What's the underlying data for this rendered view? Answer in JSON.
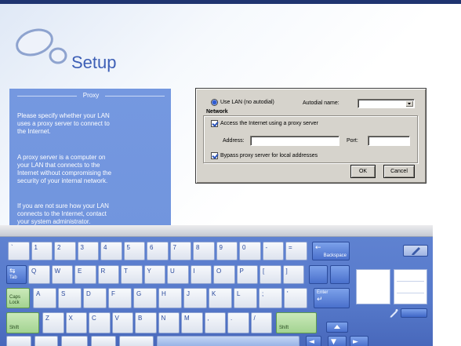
{
  "header": {
    "title": "Setup",
    "logo_icon": "bubbles-logo-icon"
  },
  "proxy_panel": {
    "heading": "Proxy",
    "paragraphs": [
      [
        "Please specify whether your LAN",
        "uses a proxy server to connect to",
        "the Internet."
      ],
      [
        "A proxy server is a computer on",
        "your LAN that connects to the",
        "Internet without compromising the",
        "security of your internal network."
      ],
      [
        "If you are not sure how your LAN",
        "connects to the Internet, contact",
        "your system administrator."
      ]
    ]
  },
  "dialog": {
    "use_lan_label": "Use LAN (no autodial)",
    "use_lan_selected": true,
    "autodial_label": "Autodial name:",
    "autodial_value": "",
    "network_label": "Network",
    "proxy_label": "Access the Internet using a proxy server",
    "proxy_checked": true,
    "address_label": "Address:",
    "address_value": "",
    "port_label": "Port:",
    "port_value": "",
    "bypass_label": "Bypass proxy server for local addresses",
    "bypass_checked": true,
    "ok_label": "OK",
    "cancel_label": "Cancel"
  },
  "keyboard": {
    "row1": [
      "`",
      "1",
      "2",
      "3",
      "4",
      "5",
      "6",
      "7",
      "8",
      "9",
      "0",
      "-",
      "=",
      "Backspace"
    ],
    "row2": [
      "Tab",
      "Q",
      "W",
      "E",
      "R",
      "T",
      "Y",
      "U",
      "I",
      "O",
      "P",
      "[",
      "]",
      "",
      ""
    ],
    "row3": [
      "Caps Lock",
      "A",
      "S",
      "D",
      "F",
      "G",
      "H",
      "J",
      "K",
      "L",
      ";",
      "'",
      "Enter"
    ],
    "row4": [
      "Shift",
      "Z",
      "X",
      "C",
      "V",
      "B",
      "N",
      "M",
      ",",
      ".",
      "/",
      "Shift"
    ],
    "row5": [
      "",
      "",
      "",
      "",
      "",
      "",
      "",
      "",
      ""
    ],
    "icons": {
      "backspace": "backspace-arrow-icon",
      "tab": "tab-arrows-icon",
      "enter": "enter-arrow-icon",
      "left": "left-arrow-icon",
      "down": "down-arrow-icon",
      "right": "right-arrow-icon",
      "up": "up-arrow-icon",
      "pen": "pen-icon"
    }
  },
  "colors": {
    "title_blue": "#3d5fb6",
    "panel_blue": "#7195de",
    "keyboard_blue": "#5679ca",
    "special_key_blue": "#4a70cc",
    "modifier_key_green": "#a3d391",
    "dialog_gray": "#d6d3cc"
  }
}
